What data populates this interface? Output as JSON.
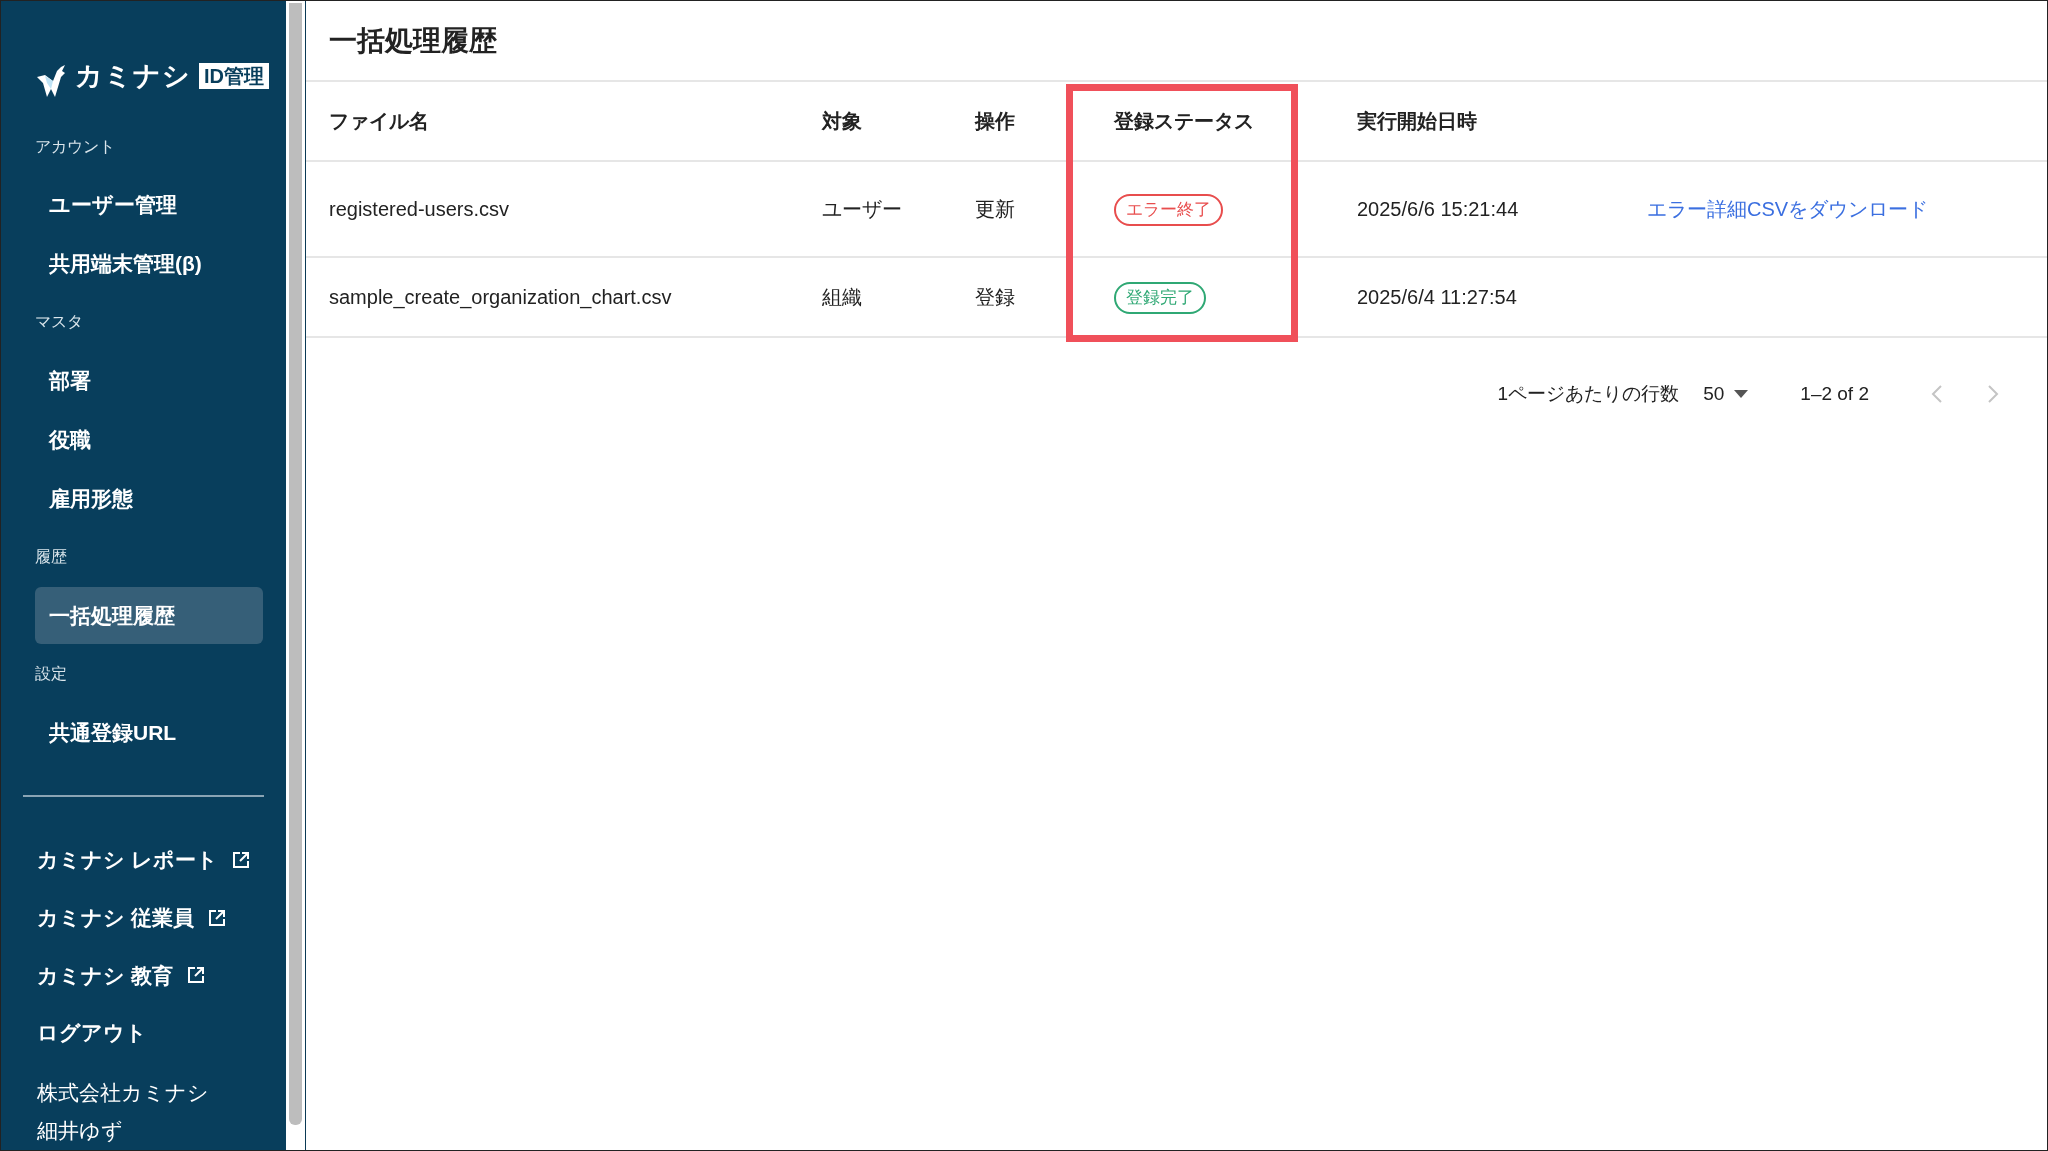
{
  "sidebar": {
    "logo": {
      "brand": "カミナシ",
      "badge": "ID管理"
    },
    "sections": [
      {
        "label": "アカウント",
        "items": [
          {
            "label": "ユーザー管理",
            "selected": false
          },
          {
            "label": "共用端末管理(β)",
            "selected": false
          }
        ]
      },
      {
        "label": "マスタ",
        "items": [
          {
            "label": "部署",
            "selected": false
          },
          {
            "label": "役職",
            "selected": false
          },
          {
            "label": "雇用形態",
            "selected": false
          }
        ]
      },
      {
        "label": "履歴",
        "items": [
          {
            "label": "一括処理履歴",
            "selected": true
          }
        ]
      },
      {
        "label": "設定",
        "items": [
          {
            "label": "共通登録URL",
            "selected": false
          }
        ]
      }
    ],
    "links": [
      {
        "label": "カミナシ レポート",
        "kind": "external"
      },
      {
        "label": "カミナシ 従業員",
        "kind": "external"
      },
      {
        "label": "カミナシ 教育",
        "kind": "external"
      },
      {
        "label": "ログアウト",
        "kind": "plain"
      }
    ],
    "account": {
      "company": "株式会社カミナシ",
      "user": "細井ゆず"
    }
  },
  "page": {
    "title": "一括処理履歴"
  },
  "table": {
    "columns": [
      {
        "label": "ファイル名",
        "highlighted": false
      },
      {
        "label": "対象",
        "highlighted": false
      },
      {
        "label": "操作",
        "highlighted": false
      },
      {
        "label": "登録ステータス",
        "highlighted": true
      },
      {
        "label": "実行開始日時",
        "highlighted": false
      }
    ],
    "rows": [
      {
        "file": "registered-users.csv",
        "target": "ユーザー",
        "operation": "更新",
        "status": {
          "label": "エラー終了",
          "kind": "error"
        },
        "started": "2025/6/6 15:21:44",
        "link": "エラー詳細CSVをダウンロード"
      },
      {
        "file": "sample_create_organization_chart.csv",
        "target": "組織",
        "operation": "登録",
        "status": {
          "label": "登録完了",
          "kind": "success"
        },
        "started": "2025/6/4 11:27:54"
      }
    ]
  },
  "pagination": {
    "rows_per_page_label": "1ページあたりの行数",
    "rows_per_page": "50",
    "range": "1–2 of 2",
    "prev_disabled": true,
    "next_disabled": true
  }
}
